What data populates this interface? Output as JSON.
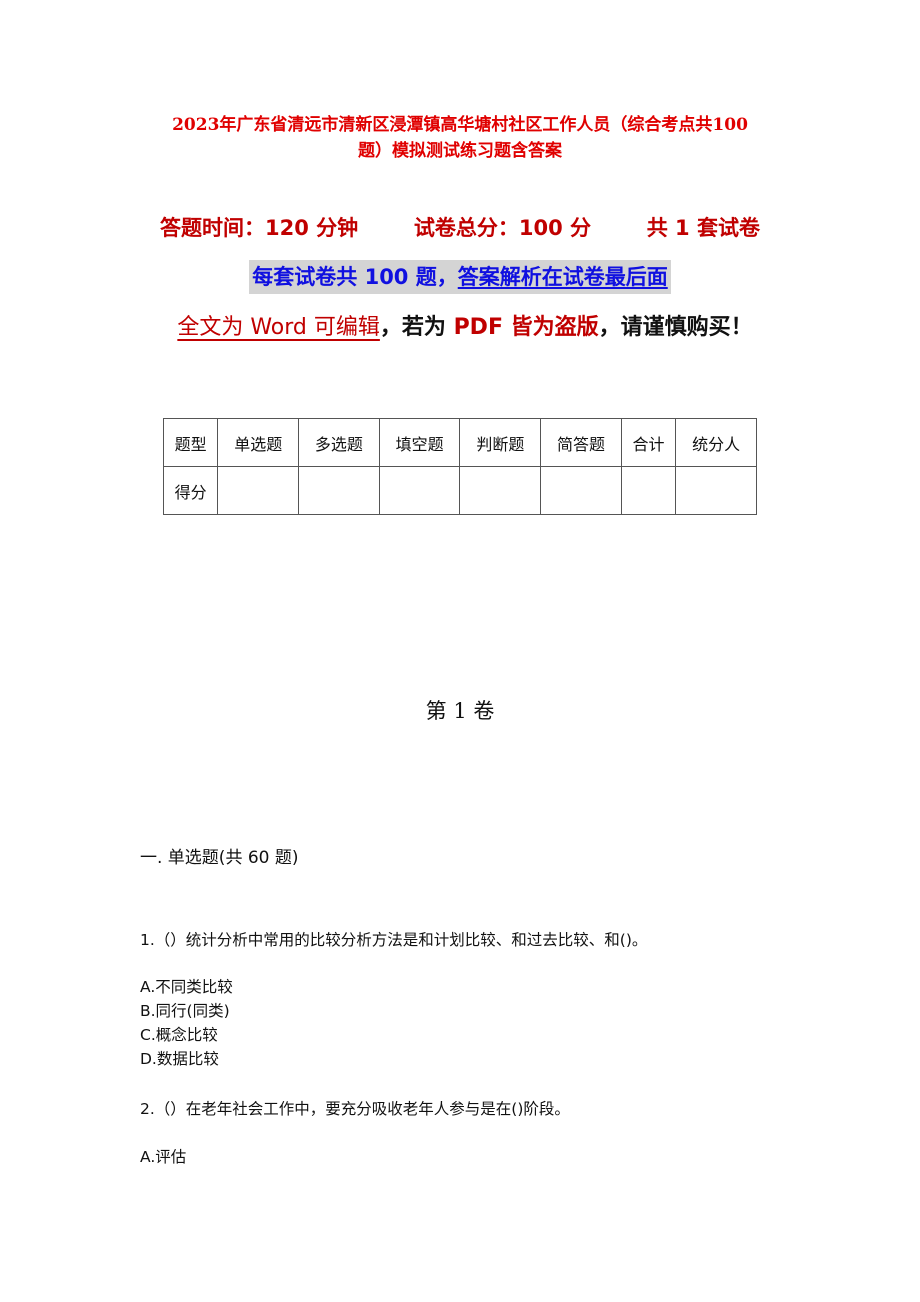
{
  "document": {
    "title_line1": "2023年广东省清远市清新区浸潭镇高华塘村社区工作人员（综合考点共100",
    "title_line2": "题）模拟测试练习题含答案",
    "meta": {
      "time": "答题时间：120 分钟",
      "total": "试卷总分：100 分",
      "sets": "共 1 套试卷"
    },
    "banner": {
      "part1": "每套试卷共 100 题，",
      "part2": "答案解析在试卷最后面"
    },
    "notice": {
      "part1": "全文为 Word 可编辑",
      "part2": "，若为 ",
      "part3": "PDF 皆为盗版",
      "part4": "，请谨慎购买！"
    },
    "colors": {
      "title_red": "#e00000",
      "meta_red": "#c00000",
      "banner_blue": "#1010e0",
      "banner_bg": "#d4d4d4"
    }
  },
  "score_table": {
    "headers": [
      "题型",
      "单选题",
      "多选题",
      "填空题",
      "判断题",
      "简答题",
      "合计",
      "统分人"
    ],
    "row_label": "得分",
    "row_values": [
      "",
      "",
      "",
      "",
      "",
      "",
      ""
    ]
  },
  "volume_title": "第 1 卷",
  "section_title": "一. 单选题(共 60 题)",
  "questions": [
    {
      "text": "1.（）统计分析中常用的比较分析方法是和计划比较、和过去比较、和()。",
      "options": [
        "A.不同类比较",
        "B.同行(同类)",
        "C.概念比较",
        "D.数据比较"
      ]
    },
    {
      "text": "2.（）在老年社会工作中，要充分吸收老年人参与是在()阶段。",
      "options": [
        "A.评估"
      ]
    }
  ]
}
